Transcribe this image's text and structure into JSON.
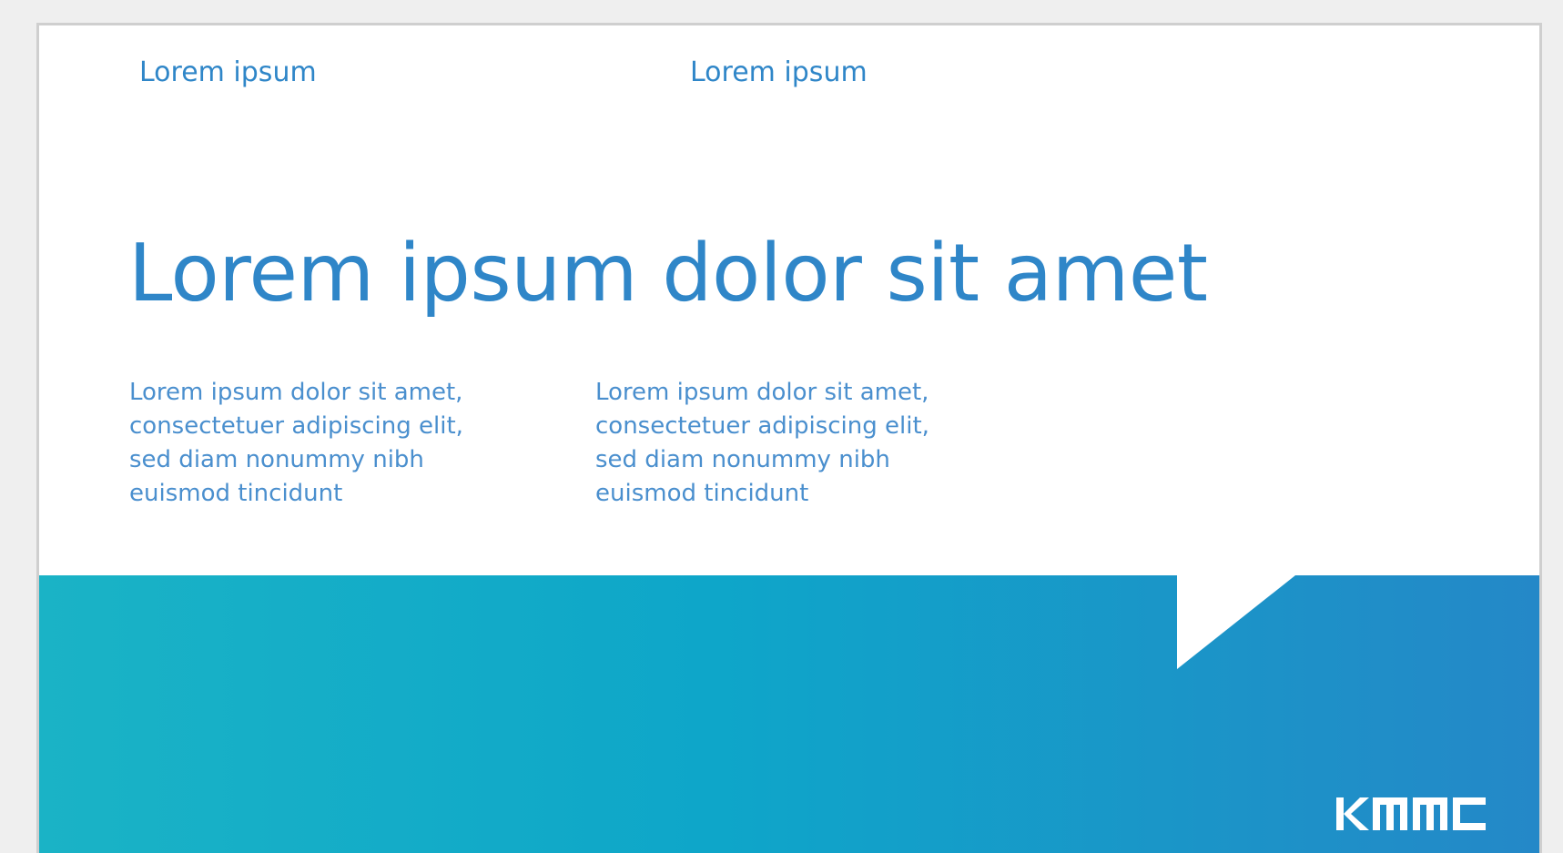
{
  "header": {
    "label_left": "Lorem ipsum",
    "label_right": "Lorem ipsum"
  },
  "headline": "Lorem ipsum dolor sit amet",
  "columns": [
    {
      "text": "Lorem ipsum dolor sit amet,\nconsectetuer adipiscing elit,\nsed diam nonummy nibh\neuismod tincidunt"
    },
    {
      "text": "Lorem ipsum dolor sit amet,\nconsectetuer adipiscing elit,\nsed diam nonummy nibh\neuismod tincidunt"
    }
  ],
  "brand": {
    "logo_text": "KMMC",
    "text_color": "#2f86c8",
    "gradient_start": "#1ab3c6",
    "gradient_mid": "#0ea6c9",
    "gradient_end": "#2488c8"
  }
}
